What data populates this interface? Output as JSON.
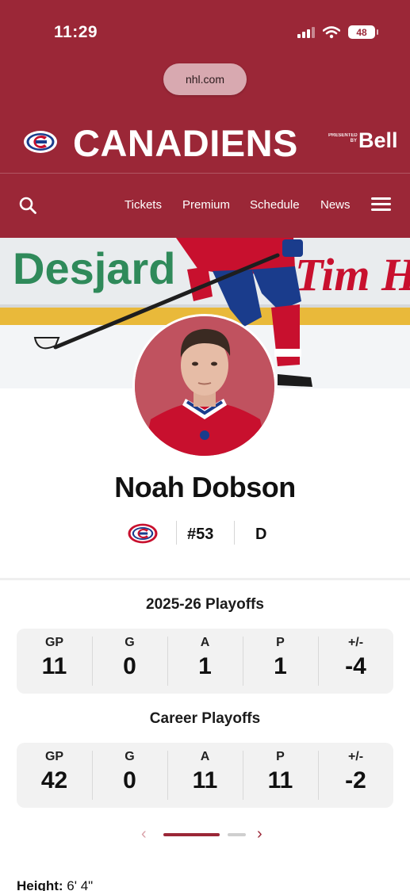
{
  "status_bar": {
    "time": "11:29",
    "battery": "48"
  },
  "browser": {
    "url": "nhl.com"
  },
  "brand": {
    "team_name": "CANADIENS",
    "sponsor_small": "PRESENTED BY",
    "sponsor": "Bell",
    "color": "#9b2737"
  },
  "nav": {
    "links": [
      "Tickets",
      "Premium",
      "Schedule",
      "News"
    ],
    "icons": [
      "search-icon",
      "hamburger-menu-icon"
    ]
  },
  "hero": {
    "board_left": "Desjard",
    "board_right": "Tim H"
  },
  "player": {
    "name": "Noah Dobson",
    "number": "#53",
    "position": "D"
  },
  "stats": [
    {
      "title": "2025-26 Playoffs",
      "columns": [
        {
          "label": "GP",
          "value": "11"
        },
        {
          "label": "G",
          "value": "0"
        },
        {
          "label": "A",
          "value": "1"
        },
        {
          "label": "P",
          "value": "1"
        },
        {
          "label": "+/-",
          "value": "-4"
        }
      ]
    },
    {
      "title": "Career Playoffs",
      "columns": [
        {
          "label": "GP",
          "value": "42"
        },
        {
          "label": "G",
          "value": "0"
        },
        {
          "label": "A",
          "value": "11"
        },
        {
          "label": "P",
          "value": "11"
        },
        {
          "label": "+/-",
          "value": "-2"
        }
      ]
    }
  ],
  "pager": {
    "prev": "‹",
    "next": "›"
  },
  "bio": {
    "height_label": "Height:",
    "height_value": "6' 4\""
  }
}
